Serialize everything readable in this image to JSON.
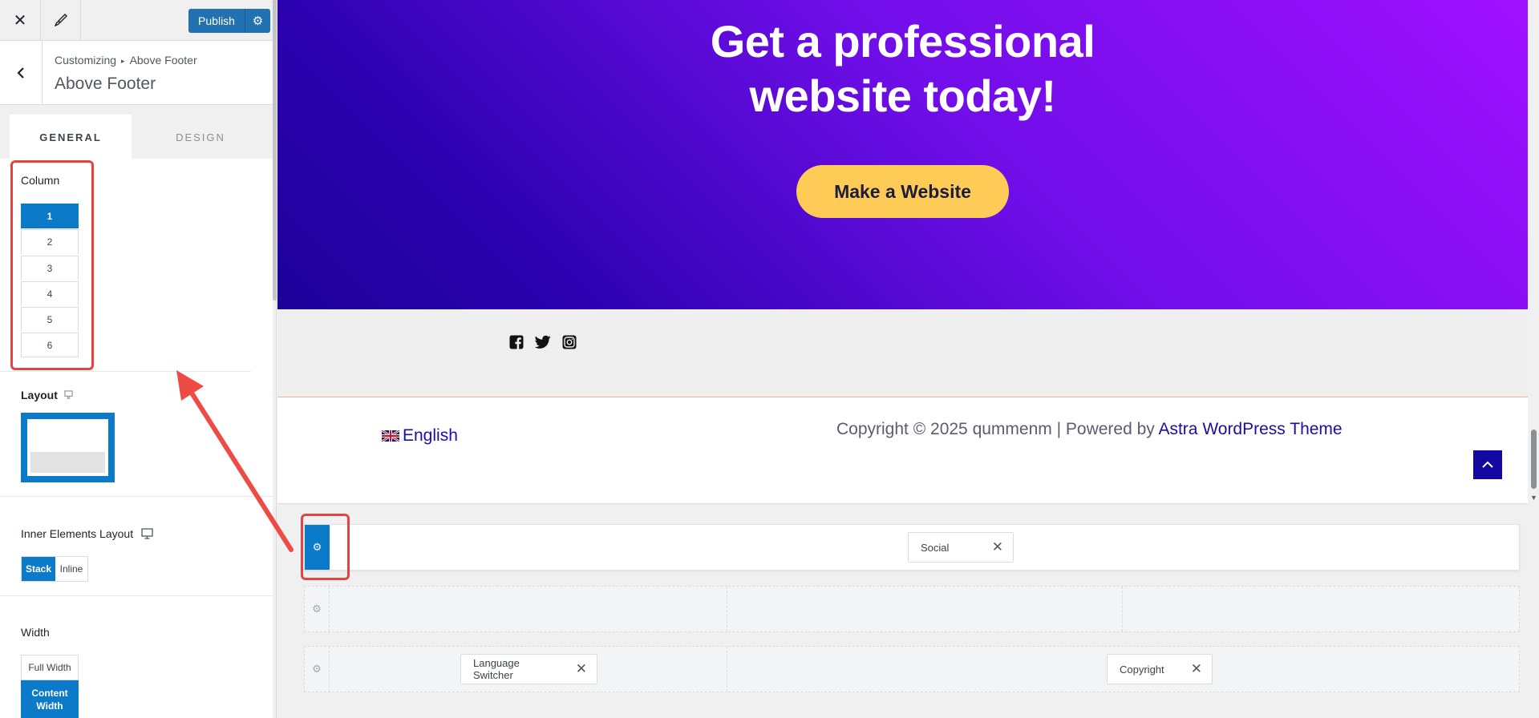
{
  "topbar": {
    "publish_label": "Publish"
  },
  "section": {
    "breadcrumb_root": "Customizing",
    "breadcrumb_current": "Above Footer",
    "title": "Above Footer"
  },
  "tabs": [
    {
      "label": "General",
      "active": true
    },
    {
      "label": "Design",
      "active": false
    }
  ],
  "column": {
    "label": "Column",
    "options": [
      "1",
      "2",
      "3",
      "4",
      "5",
      "6"
    ],
    "selected": "1"
  },
  "layout": {
    "label": "Layout"
  },
  "inner_layout": {
    "label": "Inner Elements Layout",
    "options": [
      "Stack",
      "Inline"
    ],
    "selected": "Stack"
  },
  "width": {
    "label": "Width",
    "options": [
      "Full Width",
      "Content Width"
    ],
    "selected": "Content Width"
  },
  "hero": {
    "title_line1": "Get a professional",
    "title_line2": "website today!",
    "cta_label": "Make a Website"
  },
  "footer": {
    "language": "English",
    "copyright_text": "Copyright © 2025 qummenm | Powered by ",
    "copyright_link": "Astra WordPress Theme"
  },
  "builder": {
    "row1_chip": "Social",
    "row3_chip_left": "Language Switcher",
    "row3_chip_right": "Copyright"
  },
  "colors": {
    "accent": "#0a7ac9",
    "publish": "#2271b1",
    "highlight": "#e5433f",
    "cta": "#ffcb57",
    "to_top": "#1308a1"
  }
}
